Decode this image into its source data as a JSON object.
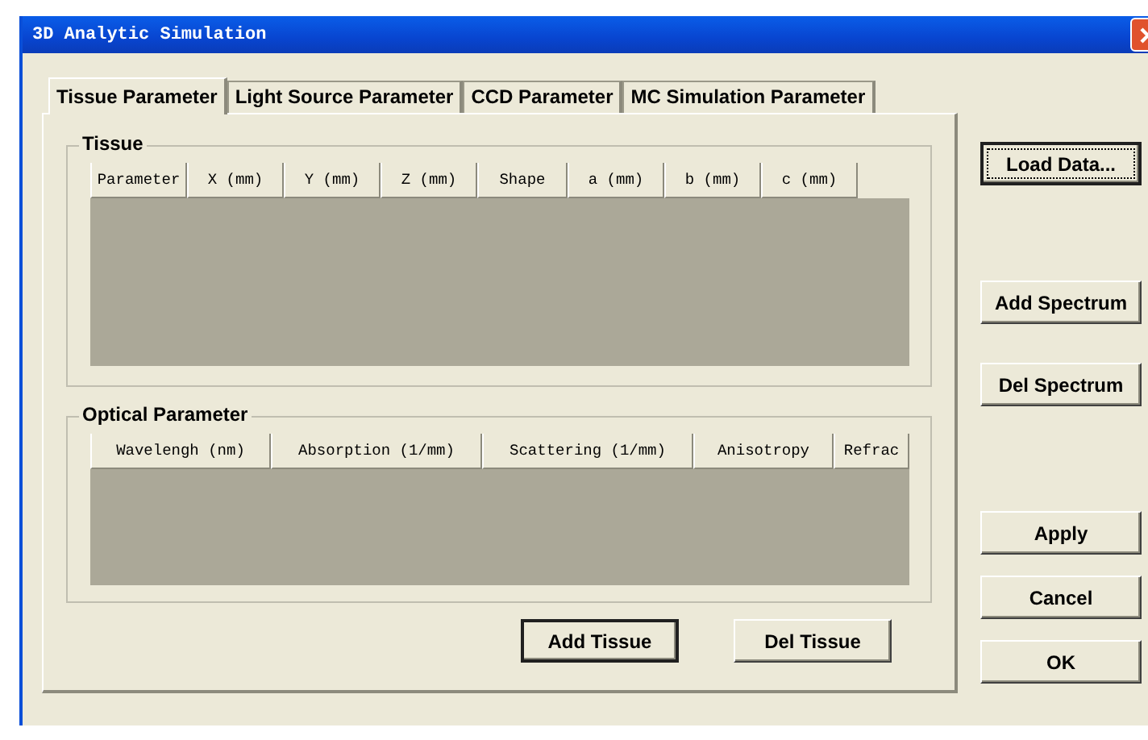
{
  "window": {
    "title": "3D Analytic Simulation"
  },
  "tabs": [
    {
      "label": "Tissue Parameter",
      "selected": true
    },
    {
      "label": "Light Source Parameter",
      "selected": false
    },
    {
      "label": "CCD Parameter",
      "selected": false
    },
    {
      "label": "MC Simulation Parameter",
      "selected": false
    }
  ],
  "tissue_group": {
    "title": "Tissue",
    "columns": [
      "Parameter",
      "X (mm)",
      "Y (mm)",
      "Z (mm)",
      "Shape",
      "a (mm)",
      "b (mm)",
      "c (mm)"
    ]
  },
  "optical_group": {
    "title": "Optical Parameter",
    "columns": [
      "Wavelengh (nm)",
      "Absorption (1/mm)",
      "Scattering (1/mm)",
      "Anisotropy",
      "Refrac"
    ]
  },
  "panel_buttons": [
    {
      "label": "Add Tissue",
      "default": true
    },
    {
      "label": "Del Tissue",
      "default": false
    }
  ],
  "side_buttons": [
    {
      "label": "Load Data...",
      "default": true
    },
    {
      "label": "Add Spectrum",
      "default": false
    },
    {
      "label": "Del Spectrum",
      "default": false
    },
    {
      "label": "Apply",
      "default": false
    },
    {
      "label": "Cancel",
      "default": false
    },
    {
      "label": "OK",
      "default": false
    }
  ]
}
